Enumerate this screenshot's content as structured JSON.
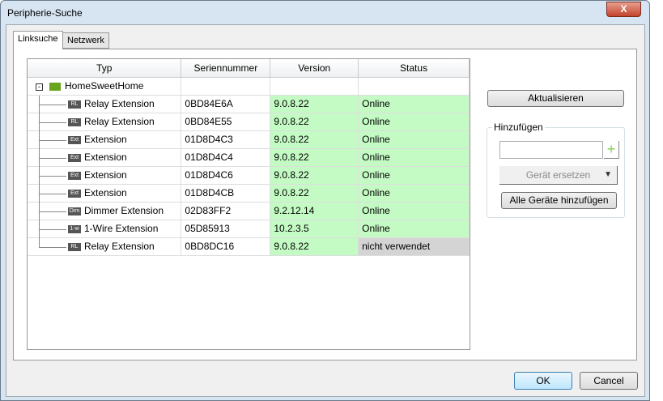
{
  "window": {
    "title": "Peripherie-Suche",
    "close": "X"
  },
  "tabs": [
    "Linksuche",
    "Netzwerk"
  ],
  "table": {
    "headers": [
      "Typ",
      "Seriennummer",
      "Version",
      "Status"
    ],
    "root": "HomeSweetHome",
    "rows": [
      {
        "icon": "RL",
        "type": "Relay Extension",
        "serial": "0BD84E6A",
        "version": "9.0.8.22",
        "status": "Online"
      },
      {
        "icon": "RL",
        "type": "Relay Extension",
        "serial": "0BD84E55",
        "version": "9.0.8.22",
        "status": "Online"
      },
      {
        "icon": "Ext",
        "type": "Extension",
        "serial": "01D8D4C3",
        "version": "9.0.8.22",
        "status": "Online"
      },
      {
        "icon": "Ext",
        "type": "Extension",
        "serial": "01D8D4C4",
        "version": "9.0.8.22",
        "status": "Online"
      },
      {
        "icon": "Ext",
        "type": "Extension",
        "serial": "01D8D4C6",
        "version": "9.0.8.22",
        "status": "Online"
      },
      {
        "icon": "Ext",
        "type": "Extension",
        "serial": "01D8D4CB",
        "version": "9.0.8.22",
        "status": "Online"
      },
      {
        "icon": "Dim",
        "type": "Dimmer Extension",
        "serial": "02D83FF2",
        "version": "9.2.12.14",
        "status": "Online"
      },
      {
        "icon": "1-w",
        "type": "1-Wire Extension",
        "serial": "05D85913",
        "version": "10.2.3.5",
        "status": "Online"
      },
      {
        "icon": "RL",
        "type": "Relay Extension",
        "serial": "0BD8DC16",
        "version": "9.0.8.22",
        "status": "nicht verwendet"
      }
    ]
  },
  "side": {
    "refresh": "Aktualisieren",
    "group": "Hinzufügen",
    "add_input": "",
    "plus": "+",
    "replace": "Gerät ersetzen",
    "add_all": "Alle Geräte hinzufügen"
  },
  "footer": {
    "ok": "OK",
    "cancel": "Cancel"
  }
}
